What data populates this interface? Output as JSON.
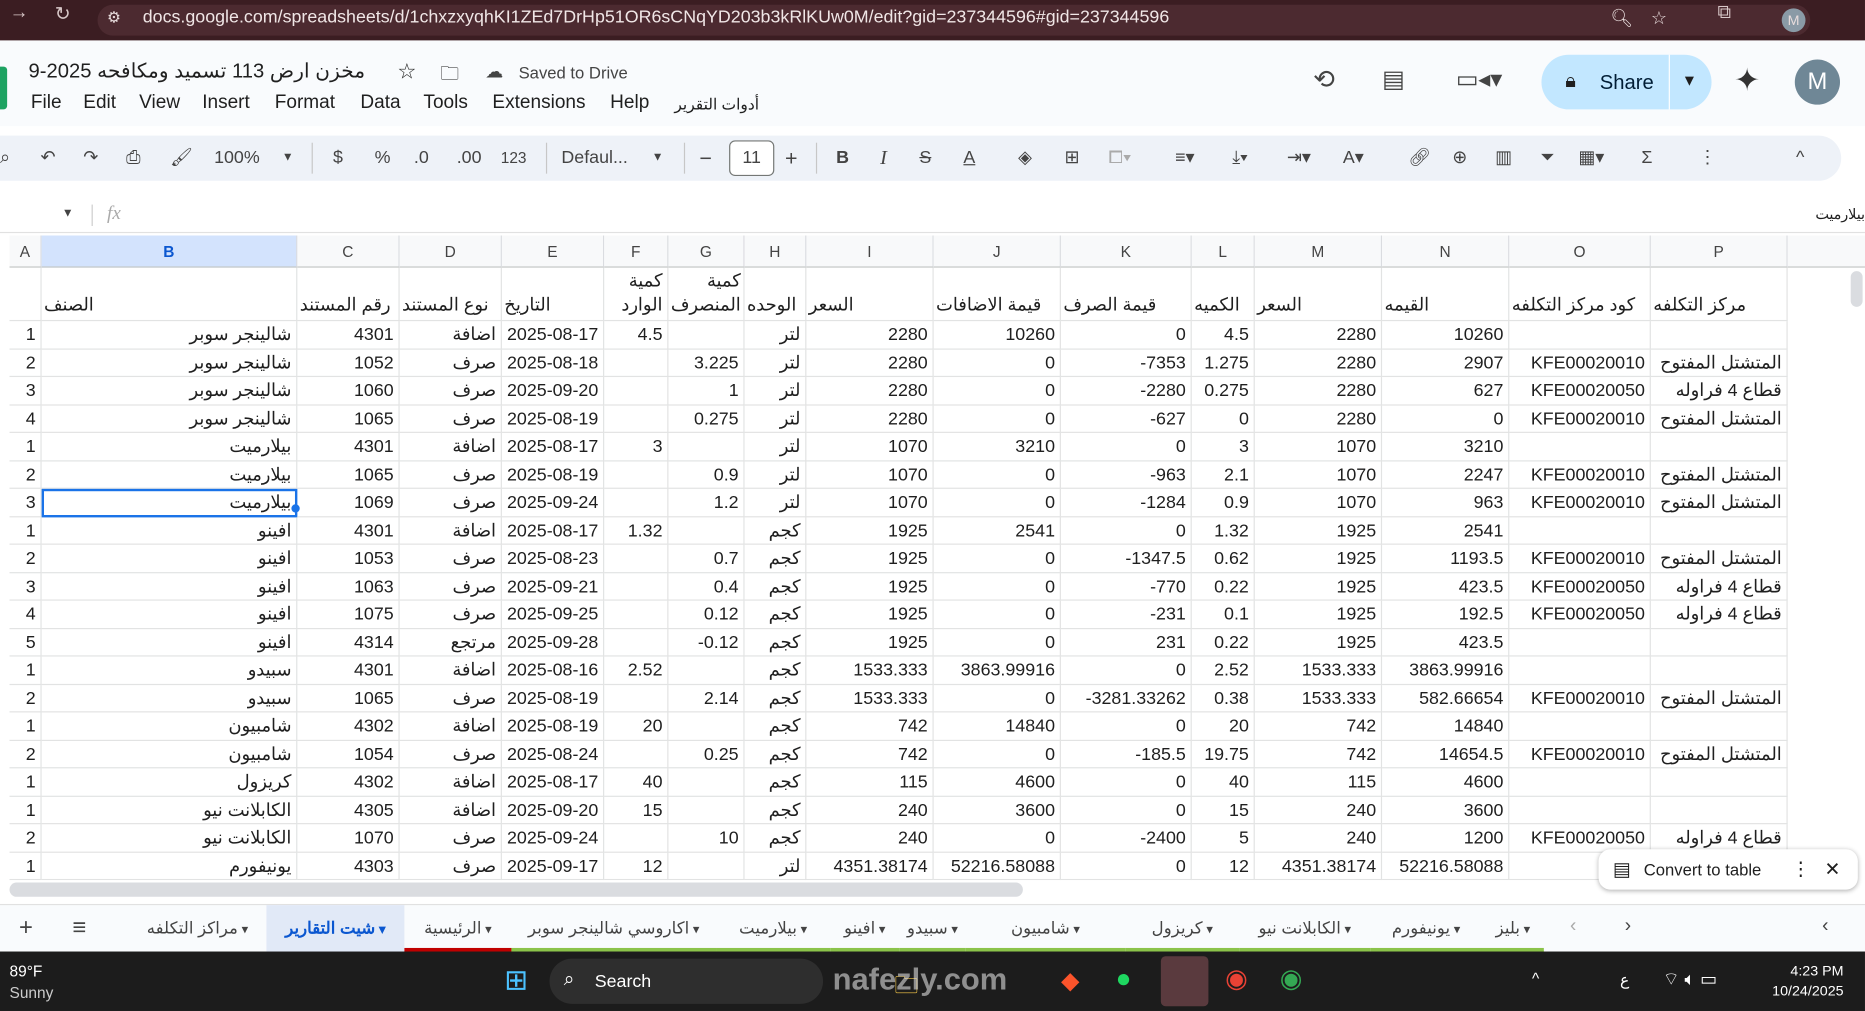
{
  "browser": {
    "url": "docs.google.com/spreadsheets/d/1chxzxyqhKI1ZEd7DrHp51OR6sCNqYD203b3kRlKUw0M/edit?gid=237344596#gid=237344596",
    "avatar": "M"
  },
  "doc": {
    "title": "مخزن ارض 113 تسميد ومكافحه 2025-9",
    "saved": "Saved to Drive",
    "share": "Share",
    "avatar": "M"
  },
  "menu": [
    "File",
    "Edit",
    "View",
    "Insert",
    "Format",
    "Data",
    "Tools",
    "Extensions",
    "Help",
    "أدوات التقرير"
  ],
  "toolbar": {
    "zoom": "100%",
    "currency": "$",
    "percent": "%",
    "dec_decrease": ".0",
    "dec_increase": ".00",
    "format": "123",
    "font": "Defaul...",
    "font_size": "11",
    "bold": "B",
    "italic": "I"
  },
  "formula": {
    "fx": "fx",
    "value": "بيلارميت"
  },
  "columns": [
    "A",
    "B",
    "C",
    "D",
    "E",
    "F",
    "G",
    "H",
    "I",
    "J",
    "K",
    "L",
    "M",
    "N",
    "O",
    "P"
  ],
  "headers": [
    "",
    "الصنف",
    "رقم المستند",
    "نوع المستند",
    "التاريخ",
    "كمية الوارد",
    "كمية المنصرف",
    "الوحده",
    "السعر",
    "قيمة الاضافات",
    "قيمة الصرف",
    "الكميه",
    "السعر",
    "القيمه",
    "كود مركز التكلفه",
    "مركز التكلفه"
  ],
  "rows": [
    [
      "1",
      "شالينجر سوبر",
      "4301",
      "اضافة",
      "2025-08-17",
      "4.5",
      "",
      "لتر",
      "2280",
      "10260",
      "0",
      "4.5",
      "2280",
      "10260",
      "",
      ""
    ],
    [
      "2",
      "شالينجر سوبر",
      "1052",
      "صرف",
      "2025-08-18",
      "",
      "3.225",
      "لتر",
      "2280",
      "0",
      "-7353",
      "1.275",
      "2280",
      "2907",
      "KFE00020010",
      "المتشتل المفتوح"
    ],
    [
      "3",
      "شالينجر سوبر",
      "1060",
      "صرف",
      "2025-09-20",
      "",
      "1",
      "لتر",
      "2280",
      "0",
      "-2280",
      "0.275",
      "2280",
      "627",
      "KFE00020050",
      "قطاع 4 فراوله"
    ],
    [
      "4",
      "شالينجر سوبر",
      "1065",
      "صرف",
      "2025-08-19",
      "",
      "0.275",
      "لتر",
      "2280",
      "0",
      "-627",
      "0",
      "2280",
      "0",
      "KFE00020010",
      "المتشتل المفتوح"
    ],
    [
      "1",
      "بيلارميت",
      "4301",
      "اضافة",
      "2025-08-17",
      "3",
      "",
      "لتر",
      "1070",
      "3210",
      "0",
      "3",
      "1070",
      "3210",
      "",
      ""
    ],
    [
      "2",
      "بيلارميت",
      "1065",
      "صرف",
      "2025-08-19",
      "",
      "0.9",
      "لتر",
      "1070",
      "0",
      "-963",
      "2.1",
      "1070",
      "2247",
      "KFE00020010",
      "المتشتل المفتوح"
    ],
    [
      "3",
      "بيلارميت",
      "1069",
      "صرف",
      "2025-09-24",
      "",
      "1.2",
      "لتر",
      "1070",
      "0",
      "-1284",
      "0.9",
      "1070",
      "963",
      "KFE00020010",
      "المتشتل المفتوح"
    ],
    [
      "1",
      "افينو",
      "4301",
      "اضافة",
      "2025-08-17",
      "1.32",
      "",
      "كجم",
      "1925",
      "2541",
      "0",
      "1.32",
      "1925",
      "2541",
      "",
      ""
    ],
    [
      "2",
      "افينو",
      "1053",
      "صرف",
      "2025-08-23",
      "",
      "0.7",
      "كجم",
      "1925",
      "0",
      "-1347.5",
      "0.62",
      "1925",
      "1193.5",
      "KFE00020010",
      "المتشتل المفتوح"
    ],
    [
      "3",
      "افينو",
      "1063",
      "صرف",
      "2025-09-21",
      "",
      "0.4",
      "كجم",
      "1925",
      "0",
      "-770",
      "0.22",
      "1925",
      "423.5",
      "KFE00020050",
      "قطاع 4 فراوله"
    ],
    [
      "4",
      "افينو",
      "1075",
      "صرف",
      "2025-09-25",
      "",
      "0.12",
      "كجم",
      "1925",
      "0",
      "-231",
      "0.1",
      "1925",
      "192.5",
      "KFE00020050",
      "قطاع 4 فراوله"
    ],
    [
      "5",
      "افينو",
      "4314",
      "مرتجع",
      "2025-09-28",
      "",
      "-0.12",
      "كجم",
      "1925",
      "0",
      "231",
      "0.22",
      "1925",
      "423.5",
      "",
      ""
    ],
    [
      "1",
      "سبيدو",
      "4301",
      "اضافة",
      "2025-08-16",
      "2.52",
      "",
      "كجم",
      "1533.333",
      "3863.99916",
      "0",
      "2.52",
      "1533.333",
      "3863.99916",
      "",
      ""
    ],
    [
      "2",
      "سبيدو",
      "1065",
      "صرف",
      "2025-08-19",
      "",
      "2.14",
      "كجم",
      "1533.333",
      "0",
      "-3281.33262",
      "0.38",
      "1533.333",
      "582.66654",
      "KFE00020010",
      "المتشتل المفتوح"
    ],
    [
      "1",
      "شامبيون",
      "4302",
      "اضافة",
      "2025-08-19",
      "20",
      "",
      "كجم",
      "742",
      "14840",
      "0",
      "20",
      "742",
      "14840",
      "",
      ""
    ],
    [
      "2",
      "شامبيون",
      "1054",
      "صرف",
      "2025-08-24",
      "",
      "0.25",
      "كجم",
      "742",
      "0",
      "-185.5",
      "19.75",
      "742",
      "14654.5",
      "KFE00020010",
      "المتشتل المفتوح"
    ],
    [
      "1",
      "كريزول",
      "4302",
      "اضافة",
      "2025-08-17",
      "40",
      "",
      "كجم",
      "115",
      "4600",
      "0",
      "40",
      "115",
      "4600",
      "",
      ""
    ],
    [
      "1",
      "الكابلانت نيو",
      "4305",
      "اضافة",
      "2025-09-20",
      "15",
      "",
      "كجم",
      "240",
      "3600",
      "0",
      "15",
      "240",
      "3600",
      "",
      ""
    ],
    [
      "2",
      "الكابلانت نيو",
      "1070",
      "صرف",
      "2025-09-24",
      "",
      "10",
      "كجم",
      "240",
      "0",
      "-2400",
      "5",
      "240",
      "1200",
      "KFE00020050",
      "قطاع 4 فراوله"
    ],
    [
      "1",
      "يونيفورم",
      "4303",
      "صرف",
      "2025-09-17",
      "12",
      "",
      "لتر",
      "4351.38174",
      "52216.58088",
      "0",
      "12",
      "4351.38174",
      "52216.58088",
      "",
      ""
    ]
  ],
  "convert_to_table": "Convert to table",
  "tabs": [
    {
      "label": "مراكز التكلفه",
      "active": false,
      "color": ""
    },
    {
      "label": "شيت التقارير",
      "active": true,
      "color": ""
    },
    {
      "label": "الرئيسية",
      "active": false,
      "color": "#c00000"
    },
    {
      "label": "اكاروسي شالينجر سوبر",
      "active": false,
      "color": "#8bc34a"
    },
    {
      "label": "بيلارميت",
      "active": false,
      "color": "#8bc34a"
    },
    {
      "label": "افينو",
      "active": false,
      "color": "#8bc34a"
    },
    {
      "label": "سبيدو",
      "active": false,
      "color": "#8bc34a"
    },
    {
      "label": "شامبيون",
      "active": false,
      "color": "#8bc34a"
    },
    {
      "label": "كريزول",
      "active": false,
      "color": "#8bc34a"
    },
    {
      "label": "الكابلانت نيو",
      "active": false,
      "color": "#8bc34a"
    },
    {
      "label": "يونيفورم",
      "active": false,
      "color": "#8bc34a"
    },
    {
      "label": "بليز",
      "active": false,
      "color": "#8bc34a"
    }
  ],
  "taskbar": {
    "temp": "89°F",
    "weather": "Sunny",
    "search": "Search",
    "lang": "ع",
    "time": "4:23 PM",
    "date": "10/24/2025"
  },
  "watermark": "nafezly.com"
}
